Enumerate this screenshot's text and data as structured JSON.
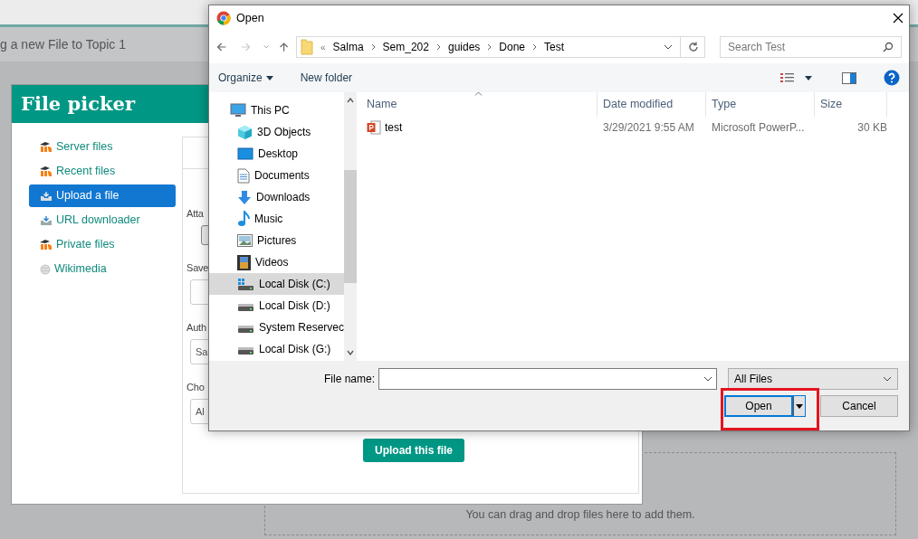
{
  "background_page": {
    "header_text": "g a new File to Topic 1",
    "drop_zone_text": "You can drag and drop files here to add them."
  },
  "file_picker": {
    "title": "File picker",
    "repositories": [
      {
        "label": "Server files",
        "selected": false
      },
      {
        "label": "Recent files",
        "selected": false
      },
      {
        "label": "Upload a file",
        "selected": true
      },
      {
        "label": "URL downloader",
        "selected": false
      },
      {
        "label": "Private files",
        "selected": false
      },
      {
        "label": "Wikimedia",
        "selected": false
      }
    ],
    "form_fields": [
      {
        "label": "Atta",
        "kind": "button"
      },
      {
        "label": "Save",
        "kind": "text"
      },
      {
        "label": "Auth",
        "kind": "text",
        "value": "Sa"
      },
      {
        "label": "Cho",
        "kind": "select",
        "value": "Al"
      }
    ],
    "upload_button": "Upload this file"
  },
  "open_dialog": {
    "title": "Open",
    "breadcrumb_prefix": "«",
    "breadcrumb": [
      "Salma",
      "Sem_202",
      "guides",
      "Done",
      "Test"
    ],
    "search": {
      "placeholder": "Search Test"
    },
    "toolbar": {
      "organize": "Organize",
      "new_folder": "New folder"
    },
    "nav_tree": [
      {
        "label": "This PC",
        "selected": false,
        "children": [
          {
            "label": "3D Objects",
            "selected": false
          },
          {
            "label": "Desktop",
            "selected": false
          },
          {
            "label": "Documents",
            "selected": false
          },
          {
            "label": "Downloads",
            "selected": false
          },
          {
            "label": "Music",
            "selected": false
          },
          {
            "label": "Pictures",
            "selected": false
          },
          {
            "label": "Videos",
            "selected": false
          },
          {
            "label": "Local Disk (C:)",
            "selected": true
          },
          {
            "label": "Local Disk (D:)",
            "selected": false
          },
          {
            "label": "System Reservec",
            "selected": false
          },
          {
            "label": "Local Disk (G:)",
            "selected": false
          }
        ]
      }
    ],
    "table": {
      "columns": [
        "Name",
        "Date modified",
        "Type",
        "Size"
      ],
      "rows": [
        {
          "name": "test",
          "date_modified": "3/29/2021 9:55 AM",
          "type": "Microsoft PowerP...",
          "size": "30 KB"
        }
      ]
    },
    "file_name_label": "File name:",
    "file_type": "All Files",
    "open_button": {
      "label": "Open",
      "highlighted": true
    },
    "cancel_button": "Cancel"
  }
}
